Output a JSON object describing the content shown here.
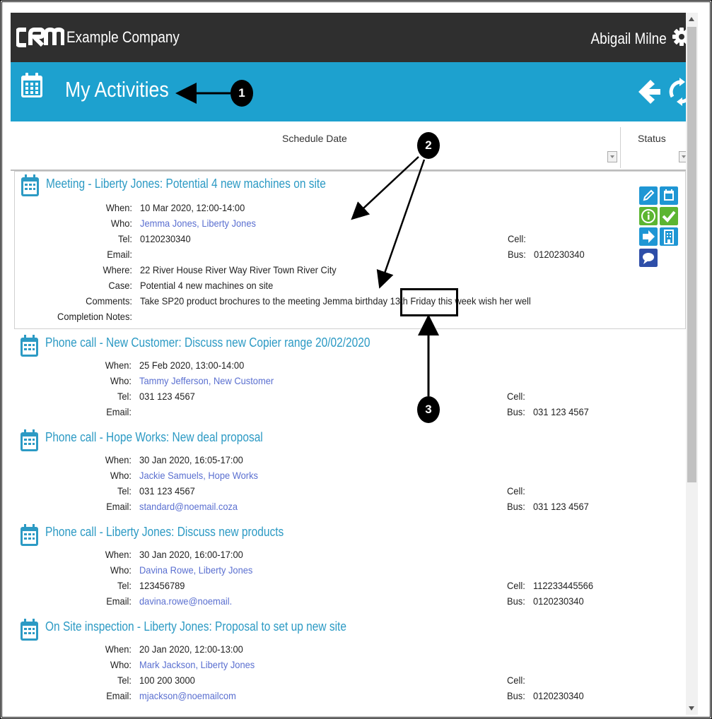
{
  "header": {
    "logo_text": "CRM",
    "company": "Example Company",
    "user": "Abigail Milne"
  },
  "titlebar": {
    "title": "My Activities"
  },
  "grid": {
    "col_schedule_date": "Schedule Date",
    "col_status": "Status"
  },
  "field_labels": {
    "when": "When:",
    "who": "Who:",
    "tel": "Tel:",
    "email": "Email:",
    "where": "Where:",
    "case": "Case:",
    "comments": "Comments:",
    "completion_notes": "Completion Notes:",
    "cell": "Cell:",
    "bus": "Bus:"
  },
  "activities": [
    {
      "title": "Meeting - Liberty Jones: Potential 4 new machines on site",
      "when": "10 Mar 2020, 12:00-14:00",
      "who": "Jemma Jones, Liberty Jones",
      "tel": "0120230340",
      "email": "",
      "cell": "",
      "bus": "0120230340",
      "where": "22 River House River Way River Town River City",
      "case": "Potential 4 new machines on site",
      "comments_before": "Take SP20 product brochures to the meeting Jemma birthday ",
      "comments_highlight": "13th Friday",
      "comments_after": " this week wish her well",
      "completion_notes": ""
    },
    {
      "title": "Phone call - New Customer: Discuss new Copier range 20/02/2020",
      "when": "25 Feb 2020, 13:00-14:00",
      "who": "Tammy Jefferson, New Customer",
      "tel": "031 123 4567",
      "email": "",
      "cell": "",
      "bus": "031 123 4567"
    },
    {
      "title": "Phone call - Hope Works: New deal proposal",
      "when": "30 Jan 2020, 16:05-17:00",
      "who": "Jackie Samuels, Hope Works",
      "tel": "031 123 4567",
      "email": "standard@noemail.coza",
      "cell": "",
      "bus": "031 123 4567"
    },
    {
      "title": "Phone call - Liberty Jones: Discuss new products",
      "when": "30 Jan 2020, 16:00-17:00",
      "who": "Davina Rowe, Liberty Jones",
      "tel": "123456789",
      "email": "davina.rowe@noemail.",
      "cell": "112233445566",
      "bus": "0120230340"
    },
    {
      "title": "On Site inspection - Liberty Jones: Proposal to set up new site",
      "when": "20 Jan 2020, 12:00-13:00",
      "who": "Mark Jackson, Liberty Jones",
      "tel": "100 200 3000",
      "email": "mjackson@noemailcom",
      "cell": "",
      "bus": "0120230340"
    }
  ],
  "status_buttons": [
    "edit-icon",
    "calendar-icon",
    "info-icon",
    "complete-icon",
    "forward-icon",
    "company-icon",
    "chat-icon"
  ],
  "annotations": {
    "marker_1": "1",
    "marker_2": "2",
    "marker_3": "3"
  },
  "colors": {
    "topbar": "#2f2f2f",
    "titlebar": "#1da1cf",
    "link": "#2c9ac4",
    "contact_link": "#5a6fd0",
    "status_blue": "#1e96d4",
    "status_green": "#5cb531",
    "status_navy": "#2e4ea8"
  }
}
